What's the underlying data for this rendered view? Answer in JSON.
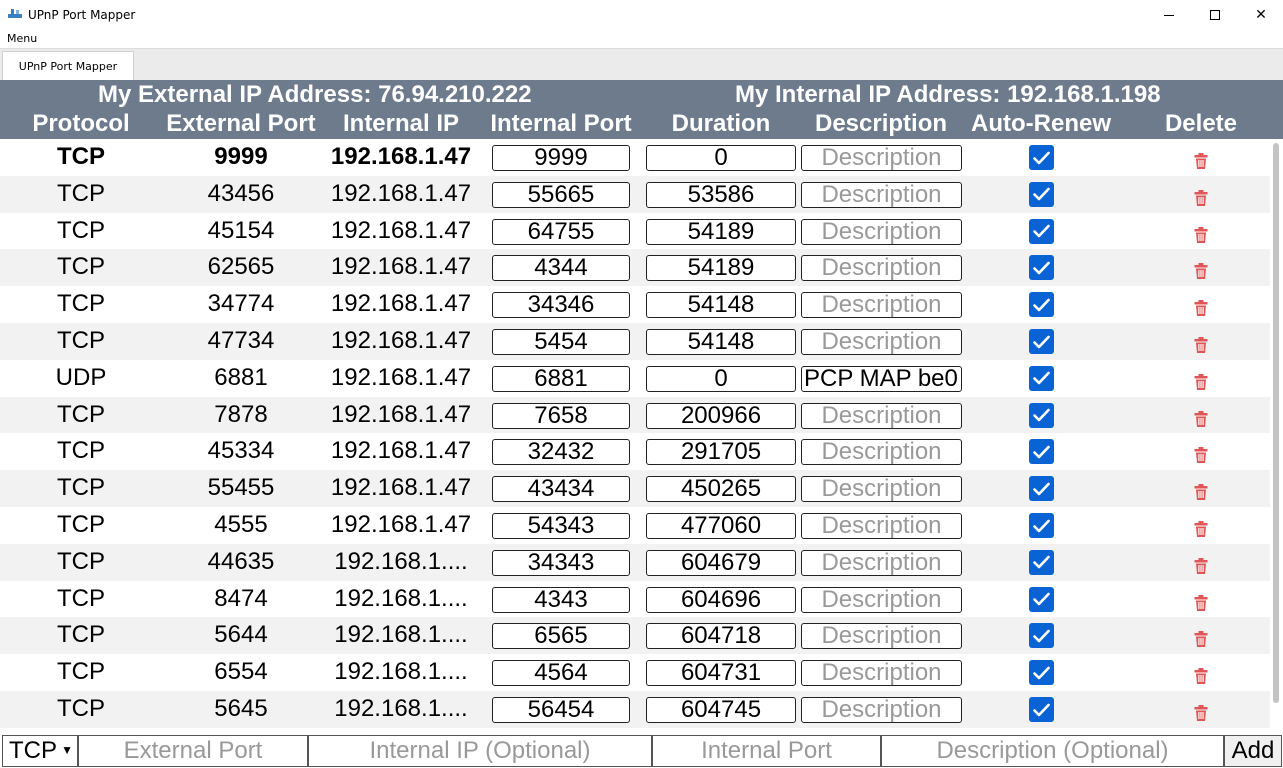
{
  "window": {
    "title": "UPnP Port Mapper"
  },
  "menu": {
    "label": "Menu"
  },
  "tab": {
    "label": "UPnP Port Mapper"
  },
  "ip": {
    "external": "My External IP Address: 76.94.210.222",
    "internal": "My Internal IP Address: 192.168.1.198"
  },
  "columns": [
    "Protocol",
    "External Port",
    "Internal IP",
    "Internal Port",
    "Duration",
    "Description",
    "Auto-Renew",
    "Delete"
  ],
  "rows": [
    {
      "protocol": "TCP",
      "external_port": "9999",
      "internal_ip": "192.168.1.47",
      "internal_port": "9999",
      "duration": "0",
      "description": "Description",
      "description_is_placeholder": true,
      "auto_renew": true,
      "bold": true
    },
    {
      "protocol": "TCP",
      "external_port": "43456",
      "internal_ip": "192.168.1.47",
      "internal_port": "55665",
      "duration": "53586",
      "description": "Description",
      "description_is_placeholder": true,
      "auto_renew": true
    },
    {
      "protocol": "TCP",
      "external_port": "45154",
      "internal_ip": "192.168.1.47",
      "internal_port": "64755",
      "duration": "54189",
      "description": "Description",
      "description_is_placeholder": true,
      "auto_renew": true
    },
    {
      "protocol": "TCP",
      "external_port": "62565",
      "internal_ip": "192.168.1.47",
      "internal_port": "4344",
      "duration": "54189",
      "description": "Description",
      "description_is_placeholder": true,
      "auto_renew": true
    },
    {
      "protocol": "TCP",
      "external_port": "34774",
      "internal_ip": "192.168.1.47",
      "internal_port": "34346",
      "duration": "54148",
      "description": "Description",
      "description_is_placeholder": true,
      "auto_renew": true
    },
    {
      "protocol": "TCP",
      "external_port": "47734",
      "internal_ip": "192.168.1.47",
      "internal_port": "5454",
      "duration": "54148",
      "description": "Description",
      "description_is_placeholder": true,
      "auto_renew": true
    },
    {
      "protocol": "UDP",
      "external_port": "6881",
      "internal_ip": "192.168.1.47",
      "internal_port": "6881",
      "duration": "0",
      "description": "PCP MAP be0",
      "description_is_placeholder": false,
      "auto_renew": true
    },
    {
      "protocol": "TCP",
      "external_port": "7878",
      "internal_ip": "192.168.1.47",
      "internal_port": "7658",
      "duration": "200966",
      "description": "Description",
      "description_is_placeholder": true,
      "auto_renew": true
    },
    {
      "protocol": "TCP",
      "external_port": "45334",
      "internal_ip": "192.168.1.47",
      "internal_port": "32432",
      "duration": "291705",
      "description": "Description",
      "description_is_placeholder": true,
      "auto_renew": true
    },
    {
      "protocol": "TCP",
      "external_port": "55455",
      "internal_ip": "192.168.1.47",
      "internal_port": "43434",
      "duration": "450265",
      "description": "Description",
      "description_is_placeholder": true,
      "auto_renew": true
    },
    {
      "protocol": "TCP",
      "external_port": "4555",
      "internal_ip": "192.168.1.47",
      "internal_port": "54343",
      "duration": "477060",
      "description": "Description",
      "description_is_placeholder": true,
      "auto_renew": true
    },
    {
      "protocol": "TCP",
      "external_port": "44635",
      "internal_ip": "192.168.1....",
      "internal_port": "34343",
      "duration": "604679",
      "description": "Description",
      "description_is_placeholder": true,
      "auto_renew": true
    },
    {
      "protocol": "TCP",
      "external_port": "8474",
      "internal_ip": "192.168.1....",
      "internal_port": "4343",
      "duration": "604696",
      "description": "Description",
      "description_is_placeholder": true,
      "auto_renew": true
    },
    {
      "protocol": "TCP",
      "external_port": "5644",
      "internal_ip": "192.168.1....",
      "internal_port": "6565",
      "duration": "604718",
      "description": "Description",
      "description_is_placeholder": true,
      "auto_renew": true
    },
    {
      "protocol": "TCP",
      "external_port": "6554",
      "internal_ip": "192.168.1....",
      "internal_port": "4564",
      "duration": "604731",
      "description": "Description",
      "description_is_placeholder": true,
      "auto_renew": true
    },
    {
      "protocol": "TCP",
      "external_port": "5645",
      "internal_ip": "192.168.1....",
      "internal_port": "56454",
      "duration": "604745",
      "description": "Description",
      "description_is_placeholder": true,
      "auto_renew": true
    }
  ],
  "add_form": {
    "protocol_value": "TCP",
    "external_port_placeholder": "External Port",
    "internal_ip_placeholder": "Internal IP (Optional)",
    "internal_port_placeholder": "Internal Port",
    "description_placeholder": "Description (Optional)",
    "add_label": "Add"
  },
  "icons": {
    "app": "network-icon",
    "delete": "trash-icon",
    "checkbox": "checkmark-icon"
  },
  "colors": {
    "header_bg": "#6d7b8d",
    "checkbox": "#0a63d4",
    "delete_icon": "#e05555"
  }
}
